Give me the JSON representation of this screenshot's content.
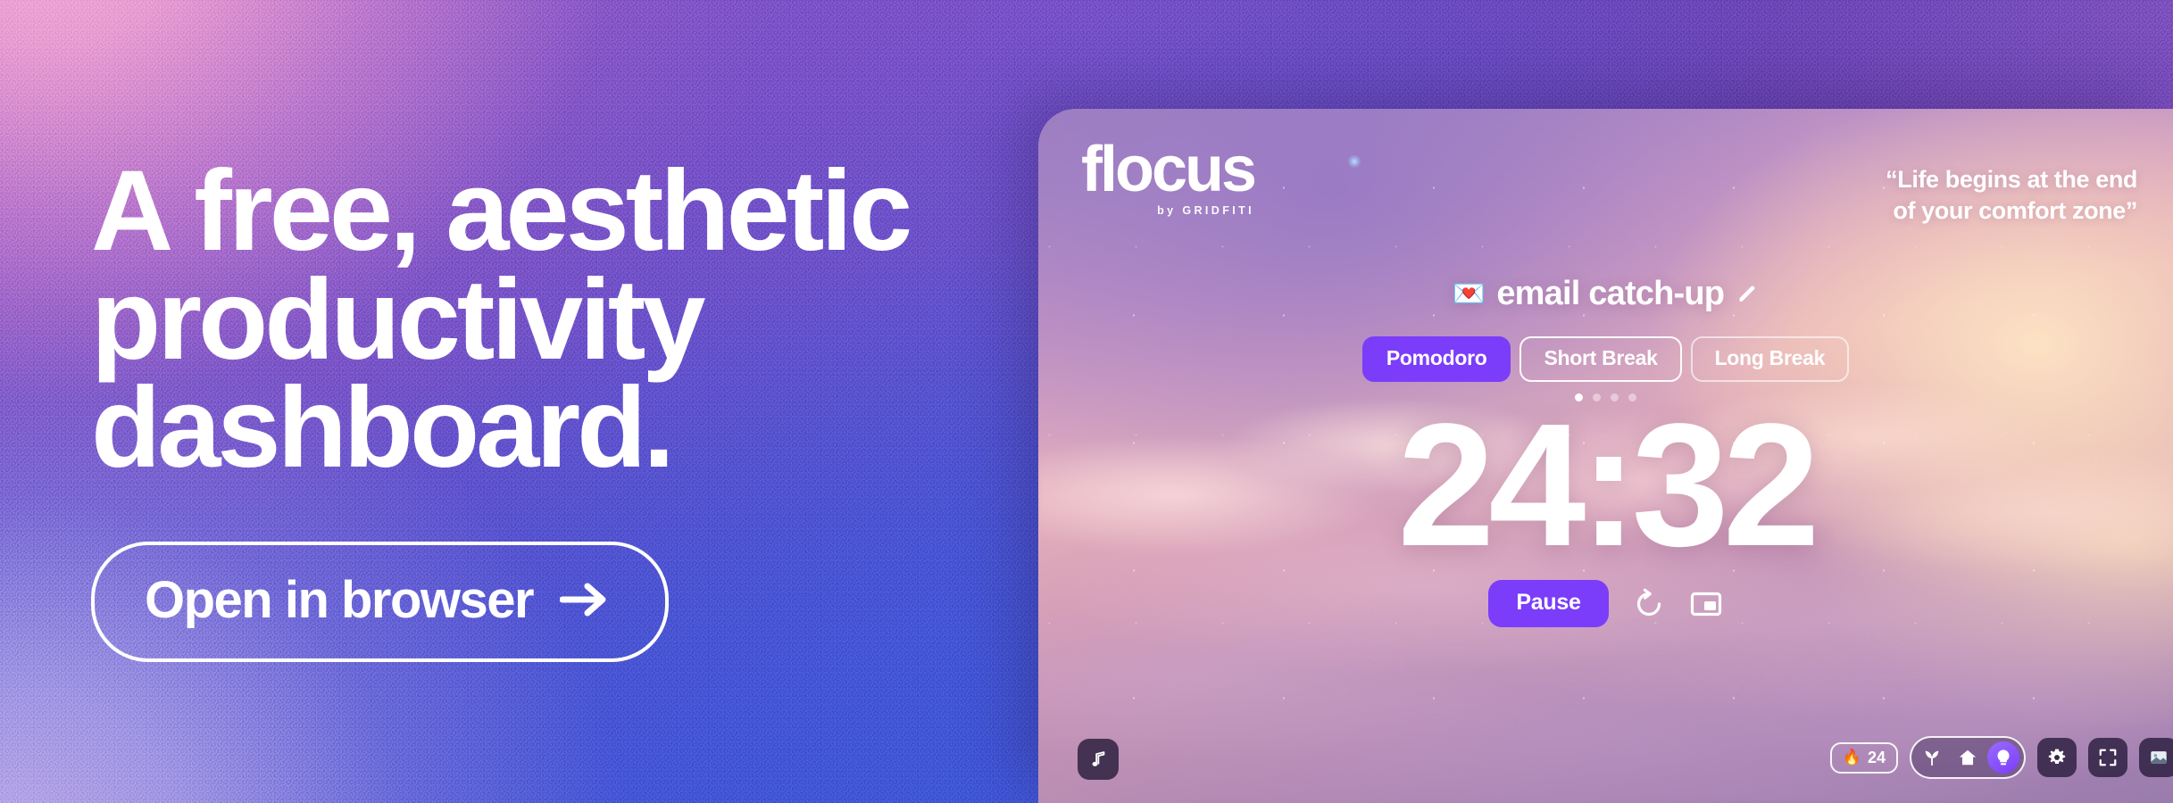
{
  "hero": {
    "headline": "A free, aesthetic\nproductivity\ndashboard.",
    "cta_label": "Open in browser",
    "cta_arrow_icon": "arrow-right-icon"
  },
  "colors": {
    "accent_purple": "#7b3dfa",
    "bg_pink": "#f4a8d8",
    "bg_purple": "#7450c6",
    "bg_blue": "#3f55d6",
    "text_white": "#ffffff"
  },
  "dashboard": {
    "logo": {
      "word": "flocus",
      "byline": "by GRIDFITI"
    },
    "quote": "“Life begins at the end\nof your comfort zone”",
    "task": {
      "emoji": "💌",
      "emoji_name": "love-letter-emoji",
      "title": "email catch-up",
      "edit_icon": "pencil-icon"
    },
    "tabs": [
      {
        "label": "Pomodoro",
        "active": true
      },
      {
        "label": "Short Break",
        "active": false
      },
      {
        "label": "Long Break",
        "active": false
      }
    ],
    "session_dots": {
      "total": 4,
      "current": 1
    },
    "timer": "24:32",
    "controls": {
      "primary_label": "Pause",
      "reset_icon": "reset-circular-arrow-icon",
      "pip_icon": "picture-in-picture-icon"
    },
    "bottom_left": {
      "music_icon": "music-note-icon"
    },
    "bottom_right": {
      "streak": {
        "flame_icon": "fire-emoji",
        "count": "24"
      },
      "modes": [
        {
          "icon": "leaf-icon",
          "selected": false
        },
        {
          "icon": "home-icon",
          "selected": false
        },
        {
          "icon": "lightbulb-icon",
          "selected": true
        }
      ],
      "buttons": [
        {
          "icon": "gear-icon"
        },
        {
          "icon": "fullscreen-icon"
        },
        {
          "icon": "wallpaper-image-icon"
        }
      ]
    }
  }
}
